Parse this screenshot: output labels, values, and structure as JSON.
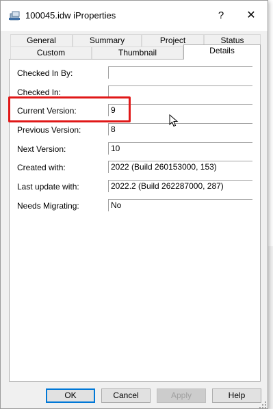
{
  "window": {
    "title": "100045.idw iProperties",
    "help_label": "?",
    "close_label": "✕"
  },
  "tabs_row1": [
    "General",
    "Summary",
    "Project",
    "Status"
  ],
  "tabs_row2": [
    "Custom",
    "Thumbnail",
    "Details"
  ],
  "active_tab": "Details",
  "fields": [
    {
      "label": "Checked In By:",
      "value": ""
    },
    {
      "label": "Checked In:",
      "value": ""
    },
    {
      "label": "Current Version:",
      "value": "9"
    },
    {
      "label": "Previous Version:",
      "value": "8"
    },
    {
      "label": "Next Version:",
      "value": "10"
    },
    {
      "label": "Created with:",
      "value": "2022 (Build 260153000, 153)"
    },
    {
      "label": "Last update with:",
      "value": "2022.2 (Build 262287000, 287)"
    },
    {
      "label": "Needs Migrating:",
      "value": "No"
    }
  ],
  "buttons": {
    "ok": "OK",
    "cancel": "Cancel",
    "apply": "Apply",
    "help": "Help"
  },
  "colors": {
    "highlight": "#e01818",
    "focus_border": "#0078d7"
  }
}
